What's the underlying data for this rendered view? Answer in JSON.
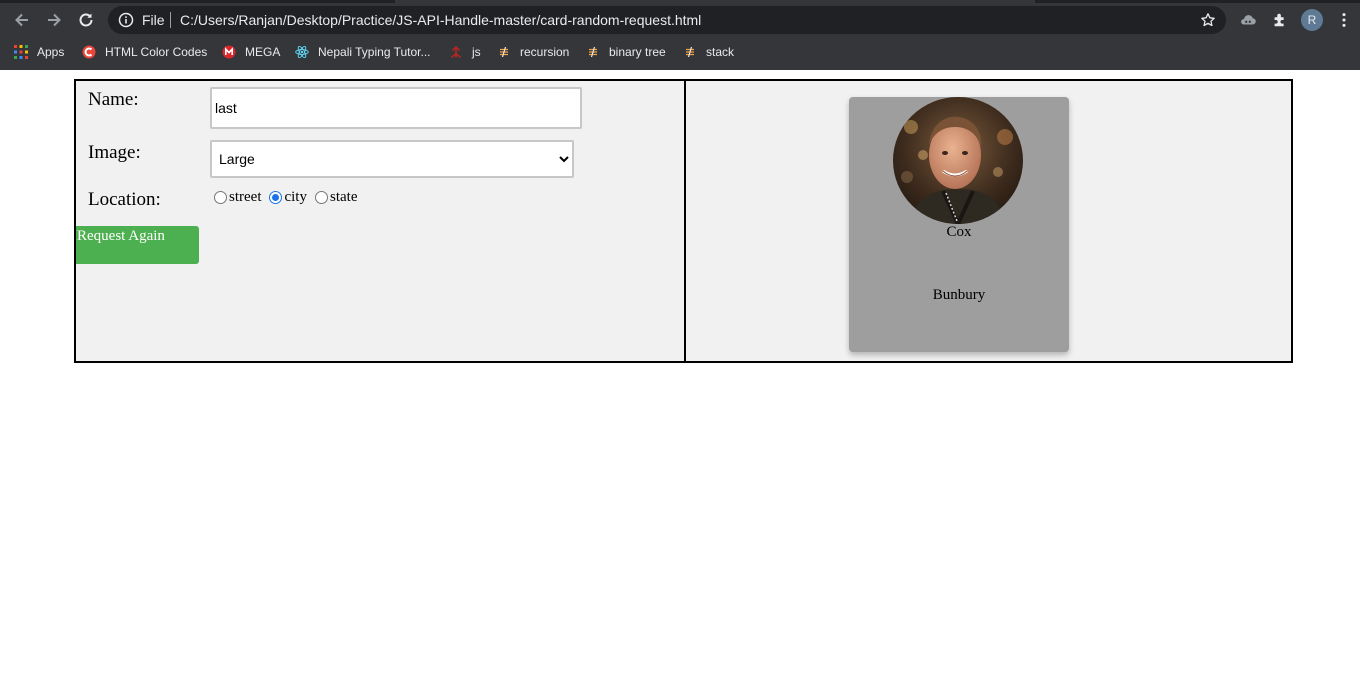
{
  "browser": {
    "url_scheme": "File",
    "url": "C:/Users/Ranjan/Desktop/Practice/JS-API-Handle-master/card-random-request.html",
    "profile_initial": "R",
    "bookmarks": [
      {
        "label": "Apps",
        "icon": "apps-grid-icon"
      },
      {
        "label": "HTML Color Codes",
        "icon": "html-color-codes-icon"
      },
      {
        "label": "MEGA",
        "icon": "mega-icon"
      },
      {
        "label": "Nepali Typing Tutor...",
        "icon": "react-icon"
      },
      {
        "label": "js",
        "icon": "js-icon"
      },
      {
        "label": "recursion",
        "icon": "recursion-icon"
      },
      {
        "label": "binary tree",
        "icon": "binary-tree-icon"
      },
      {
        "label": "stack",
        "icon": "stack-icon"
      }
    ]
  },
  "form": {
    "name_label": "Name:",
    "name_value": "last",
    "image_label": "Image:",
    "image_selected": "Large",
    "location_label": "Location:",
    "location_options": [
      "street",
      "city",
      "state"
    ],
    "location_selected": "city",
    "request_button_label": "Request Again"
  },
  "card": {
    "name": "Cox",
    "location": "Bunbury"
  },
  "colors": {
    "request_button": "#4caf50",
    "card_background": "#9e9e9e",
    "panel_background": "#f1f1f1",
    "chrome_background": "#35363a"
  }
}
